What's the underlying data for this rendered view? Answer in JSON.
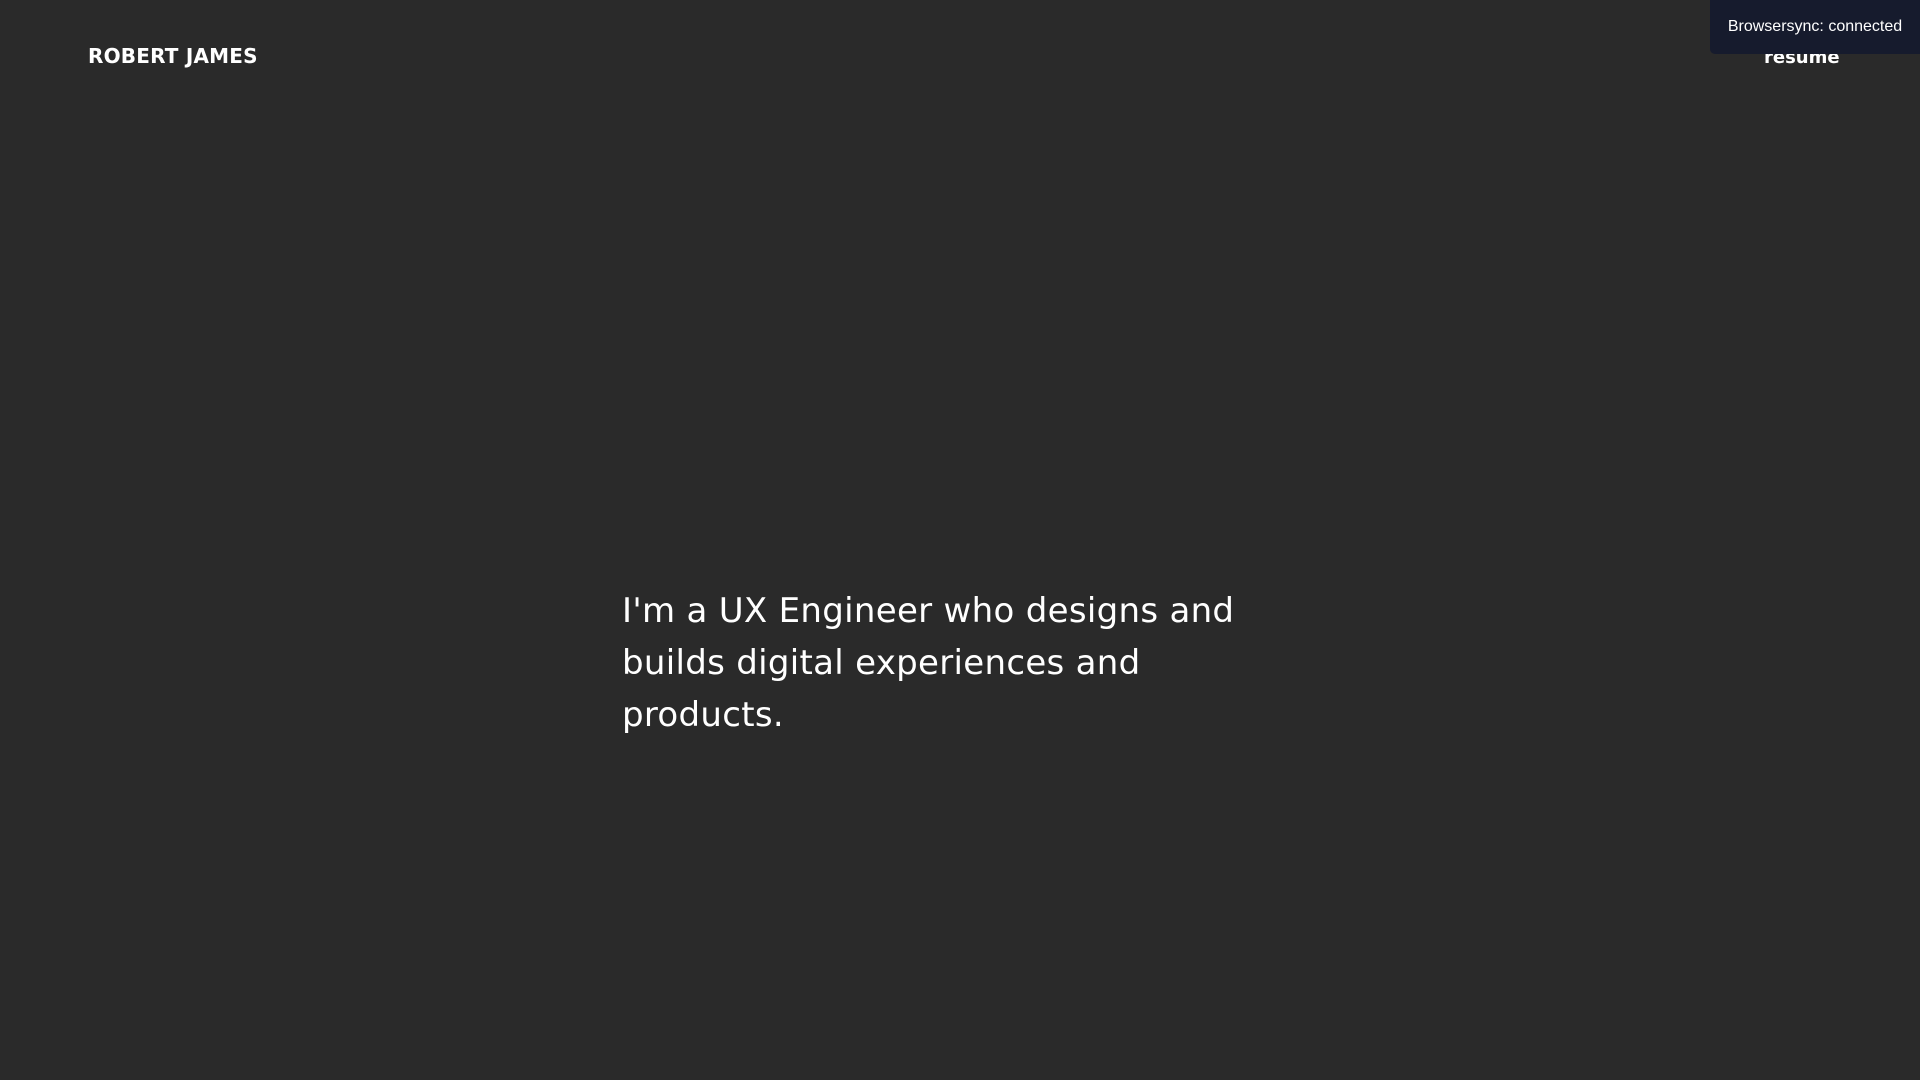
{
  "header": {
    "logo": "ROBERT JAMES",
    "nav_resume": "resume"
  },
  "hero": {
    "text": "I'm a UX Engineer who designs and builds digital experiences and products."
  },
  "browsersync": {
    "message": "Browsersync: connected"
  },
  "colors": {
    "background": "#2a2a2a",
    "text": "#ffffff",
    "notification_bg": "#161b2d"
  }
}
